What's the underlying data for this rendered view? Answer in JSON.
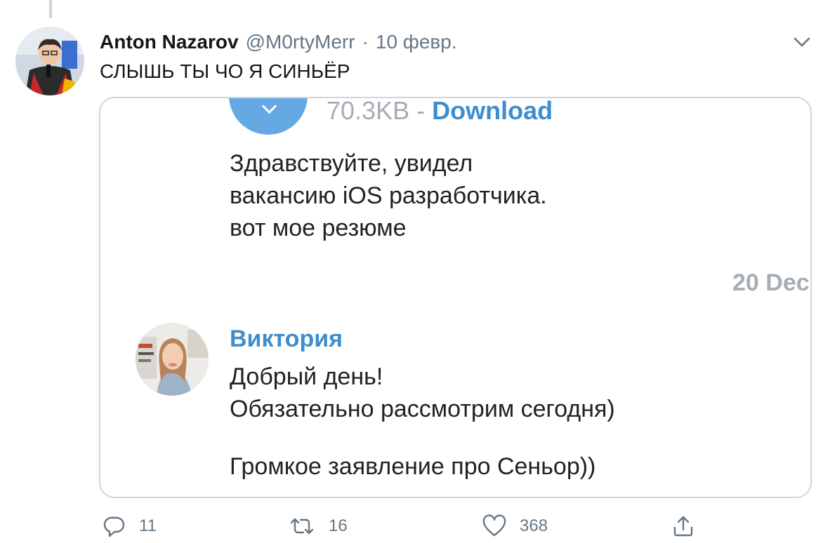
{
  "tweet": {
    "author_name": "Anton Nazarov",
    "handle": "@M0rtyMerr",
    "separator": "·",
    "date": "10 февр.",
    "text": "СЛЫШЬ ТЫ ЧО Я СИНЬЁР"
  },
  "media": {
    "file": {
      "size": "70.3KB",
      "dash": "-",
      "download_label": "Download",
      "icon": "download-arrow-icon"
    },
    "messages": [
      {
        "lines": [
          "Здравствуйте, увидел",
          "вакансию iOS разработчика.",
          "вот мое резюме"
        ]
      },
      {
        "sender": "Виктория",
        "lines": [
          "Добрый день!",
          "Обязательно рассмотрим сегодня)"
        ]
      },
      {
        "lines": [
          "Громкое заявление про Сеньор))"
        ]
      }
    ],
    "date_label": "20 Dec"
  },
  "actions": {
    "reply_count": "11",
    "retweet_count": "16",
    "like_count": "368"
  },
  "colors": {
    "link_blue": "#3e8dcf",
    "file_circle": "#64a9e4",
    "muted_gray": "#657786",
    "border": "#ccd6dd"
  }
}
